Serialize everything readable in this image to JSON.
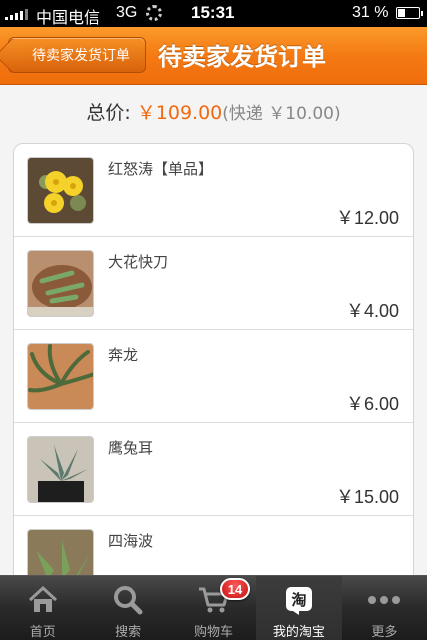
{
  "status_bar": {
    "carrier": "中国电信",
    "network": "3G",
    "time": "15:31",
    "battery_percent": "31 %"
  },
  "nav": {
    "back_label": "待卖家发货订单",
    "title": "待卖家发货订单",
    "accent_color": "#f47a14"
  },
  "summary": {
    "total_label": "总价:",
    "total_value": "￥109.00",
    "shipping_note": "(快递 ￥10.00)",
    "price_color": "#f06a0e"
  },
  "items": [
    {
      "name": "红怒涛【单品】",
      "price": "￥12.00",
      "thumb_icon": "plant-photo-yellow-flower"
    },
    {
      "name": "大花快刀",
      "price": "￥4.00",
      "thumb_icon": "plant-photo-succulent"
    },
    {
      "name": "奔龙",
      "price": "￥6.00",
      "thumb_icon": "plant-photo-succulent-pot"
    },
    {
      "name": "鹰兔耳",
      "price": "￥15.00",
      "thumb_icon": "plant-photo-rosette"
    },
    {
      "name": "四海波",
      "price": "",
      "thumb_icon": "plant-photo-green"
    }
  ],
  "tabs": [
    {
      "label": "首页",
      "icon": "home-icon",
      "active": false
    },
    {
      "label": "搜索",
      "icon": "search-icon",
      "active": false
    },
    {
      "label": "购物车",
      "icon": "cart-icon",
      "active": false
    },
    {
      "label": "我的淘宝",
      "icon": "taobao-icon",
      "active": true
    },
    {
      "label": "更多",
      "icon": "more-icon",
      "active": false
    }
  ],
  "cart_badge": "14"
}
